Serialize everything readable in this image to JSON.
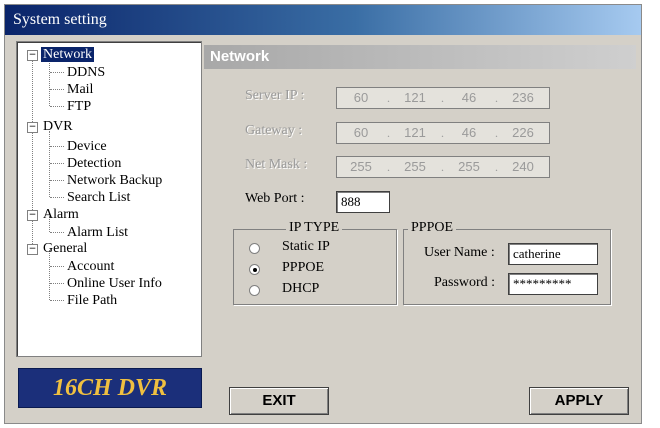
{
  "window": {
    "title": "System setting"
  },
  "tree": {
    "network": "Network",
    "ddns": "DDNS",
    "mail": "Mail",
    "ftp": "FTP",
    "dvr": "DVR",
    "device": "Device",
    "detection": "Detection",
    "network_backup": "Network Backup",
    "search_list": "Search List",
    "alarm": "Alarm",
    "alarm_list": "Alarm List",
    "general": "General",
    "account": "Account",
    "online_user_info": "Online User Info",
    "file_path": "File Path"
  },
  "logo": "16CH DVR",
  "panel": {
    "title": "Network",
    "server_ip_label": "Server IP :",
    "server_ip": [
      "60",
      "121",
      "46",
      "236"
    ],
    "gateway_label": "Gateway :",
    "gateway": [
      "60",
      "121",
      "46",
      "226"
    ],
    "netmask_label": "Net Mask :",
    "netmask": [
      "255",
      "255",
      "255",
      "240"
    ],
    "web_port_label": "Web Port :",
    "web_port": "888"
  },
  "ip_type": {
    "title": "IP TYPE",
    "static": "Static IP",
    "pppoe": "PPPOE",
    "dhcp": "DHCP",
    "selected": "PPPOE"
  },
  "pppoe": {
    "title": "PPPOE",
    "user_label": "User Name :",
    "user_value": "catherine",
    "password_label": "Password :",
    "password_value": "*********"
  },
  "buttons": {
    "exit": "EXIT",
    "apply": "APPLY"
  }
}
